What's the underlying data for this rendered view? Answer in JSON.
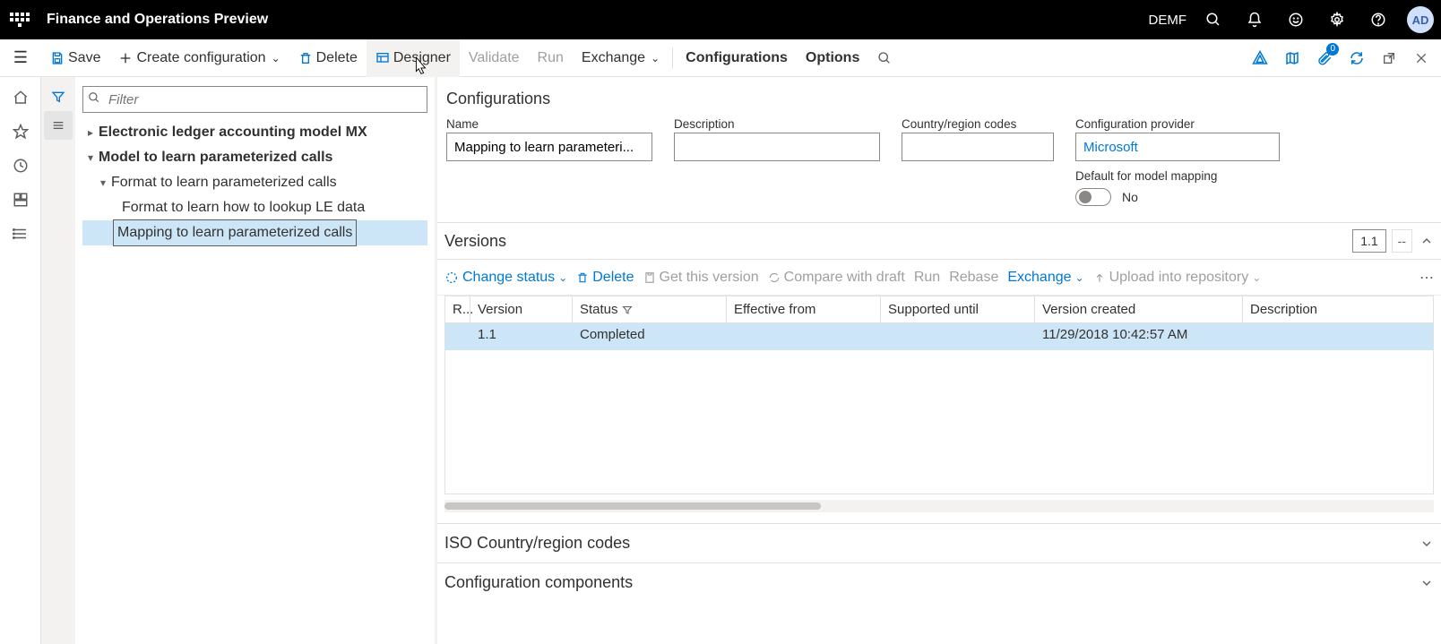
{
  "topbar": {
    "app_title": "Finance and Operations Preview",
    "company": "DEMF",
    "avatar": "AD"
  },
  "toolbar": {
    "save": "Save",
    "create_config": "Create configuration",
    "delete": "Delete",
    "designer": "Designer",
    "validate": "Validate",
    "run": "Run",
    "exchange": "Exchange",
    "configurations": "Configurations",
    "options": "Options",
    "attachments_count": "0"
  },
  "filter": {
    "placeholder": "Filter"
  },
  "tree": {
    "root": "Electronic ledger accounting model MX",
    "n1": "Model to learn parameterized calls",
    "n2": "Format to learn parameterized calls",
    "n3": "Format to learn how to lookup LE data",
    "n4": "Mapping to learn parameterized calls"
  },
  "details": {
    "section": "Configurations",
    "labels": {
      "name": "Name",
      "desc": "Description",
      "crc": "Country/region codes",
      "cp": "Configuration provider",
      "default": "Default for model mapping"
    },
    "name_value": "Mapping to learn parameteri...",
    "desc_value": "",
    "crc_value": "",
    "cp_value": "Microsoft",
    "default_value": "No"
  },
  "versions": {
    "title": "Versions",
    "badge": "1.1",
    "sep": "--",
    "toolbar": {
      "change_status": "Change status",
      "delete": "Delete",
      "get": "Get this version",
      "compare": "Compare with draft",
      "run": "Run",
      "rebase": "Rebase",
      "exchange": "Exchange",
      "upload": "Upload into repository"
    },
    "columns": {
      "r": "R...",
      "version": "Version",
      "status": "Status",
      "eff": "Effective from",
      "supp": "Supported until",
      "vc": "Version created",
      "desc": "Description"
    },
    "row": {
      "version": "1.1",
      "status": "Completed",
      "eff": "",
      "supp": "",
      "vc": "11/29/2018 10:42:57 AM",
      "desc": ""
    }
  },
  "sections": {
    "iso": "ISO Country/region codes",
    "comp": "Configuration components"
  }
}
